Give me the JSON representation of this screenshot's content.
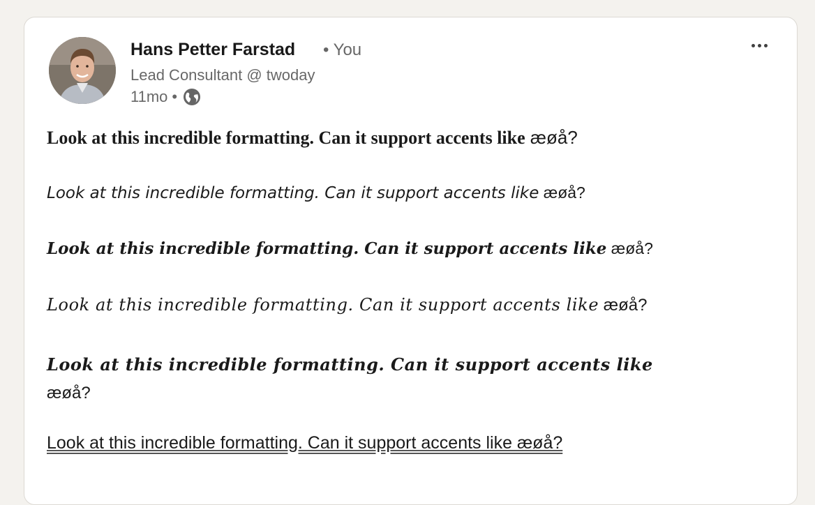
{
  "post": {
    "author": {
      "name": "Hans Petter Farstad",
      "relation": "• You",
      "headline": "Lead Consultant @ twoday",
      "age": "11mo",
      "separator": "•",
      "visibility_icon": "globe-icon"
    },
    "more_icon": "ellipsis-icon",
    "lines": [
      {
        "styled": "Look at this incredible formatting. Can it support accents like",
        "suffix": " æøå?"
      },
      {
        "styled": "Look at this incredible formatting. Can it support accents like",
        "suffix": " æøå?"
      },
      {
        "styled": "Look at this incredible formatting. Can it support accents like",
        "suffix": " æøå?"
      },
      {
        "styled": "Look at this incredible formatting. Can it support accents like",
        "suffix": " æøå?"
      },
      {
        "styled": "Look at this incredible formatting. Can it support accents like",
        "suffix": " æøå?"
      },
      {
        "styled": "Look at this incredible formatting. Can it support accents like æøå?",
        "suffix": ""
      }
    ]
  },
  "colors": {
    "page_background": "#f4f2ee",
    "card_background": "#ffffff",
    "text_primary": "#1a1a1a",
    "text_secondary": "#666666"
  }
}
